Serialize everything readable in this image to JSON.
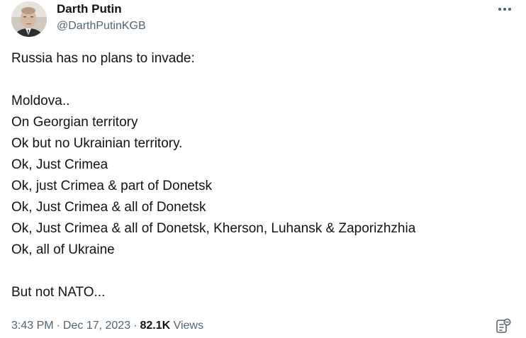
{
  "author": {
    "display_name": "Darth Putin",
    "handle": "@DarthPutinKGB"
  },
  "tweet": {
    "lines": [
      "Russia has no plans to invade:",
      "",
      "Moldova..",
      "On Georgian territory",
      "Ok but no Ukrainian territory.",
      "Ok, Just Crimea",
      "Ok, just Crimea & part of Donetsk",
      "Ok, Just Crimea & all of Donetsk",
      "Ok, Just Crimea & all of Donetsk, Kherson, Luhansk & Zaporizhzhia",
      "Ok, all of Ukraine",
      "",
      "But not NATO..."
    ]
  },
  "meta": {
    "time": "3:43 PM",
    "separator": "·",
    "date": "Dec 17, 2023",
    "views_count": "82.1K",
    "views_label": "Views"
  },
  "icons": {
    "more": "more-horizontal-icon",
    "analytics": "analytics-icon"
  },
  "colors": {
    "text_primary": "#0f1419",
    "text_secondary": "#536471",
    "background": "#ffffff"
  }
}
